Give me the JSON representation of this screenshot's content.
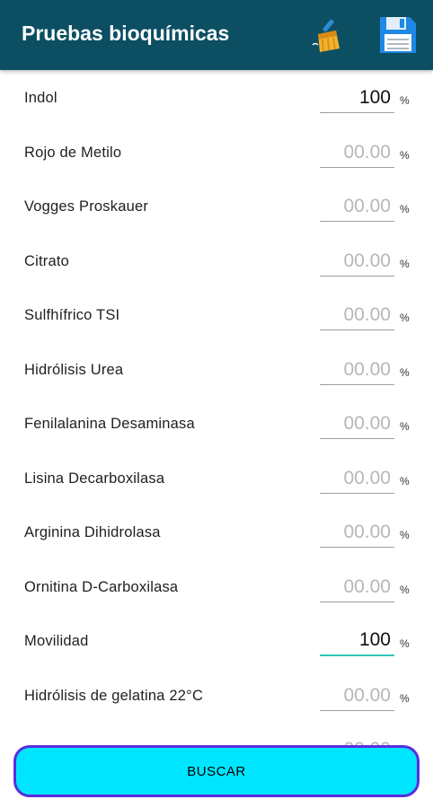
{
  "app_bar": {
    "title": "Pruebas bioquímicas",
    "clean_icon": "broom-icon",
    "save_icon": "floppy-disk-icon",
    "background": "#0c4f63"
  },
  "fields": [
    {
      "label": "Indol",
      "value": "100",
      "placeholder": "00.00",
      "unit": "%"
    },
    {
      "label": "Rojo de Metilo",
      "value": "",
      "placeholder": "00.00",
      "unit": "%"
    },
    {
      "label": "Vogges Proskauer",
      "value": "",
      "placeholder": "00.00",
      "unit": "%"
    },
    {
      "label": "Citrato",
      "value": "",
      "placeholder": "00.00",
      "unit": "%"
    },
    {
      "label": "Sulfhífrico TSI",
      "value": "",
      "placeholder": "00.00",
      "unit": "%"
    },
    {
      "label": "Hidrólisis Urea",
      "value": "",
      "placeholder": "00.00",
      "unit": "%"
    },
    {
      "label": "Fenilalanina Desaminasa",
      "value": "",
      "placeholder": "00.00",
      "unit": "%"
    },
    {
      "label": "Lisina Decarboxilasa",
      "value": "",
      "placeholder": "00.00",
      "unit": "%"
    },
    {
      "label": "Arginina Dihidrolasa",
      "value": "",
      "placeholder": "00.00",
      "unit": "%"
    },
    {
      "label": "Ornitina D-Carboxilasa",
      "value": "",
      "placeholder": "00.00",
      "unit": "%"
    },
    {
      "label": "Movilidad",
      "value": "100",
      "placeholder": "00.00",
      "unit": "%"
    },
    {
      "label": "Hidrólisis de gelatina 22°C",
      "value": "",
      "placeholder": "00.00",
      "unit": "%"
    },
    {
      "label": "",
      "value": "",
      "placeholder": "00.00",
      "unit": ""
    }
  ],
  "search_button": {
    "label": "BUSCAR",
    "color": "#00e5ff",
    "border_color": "#5a2de0"
  },
  "colors": {
    "focus_underline": "#2fc6b8"
  }
}
